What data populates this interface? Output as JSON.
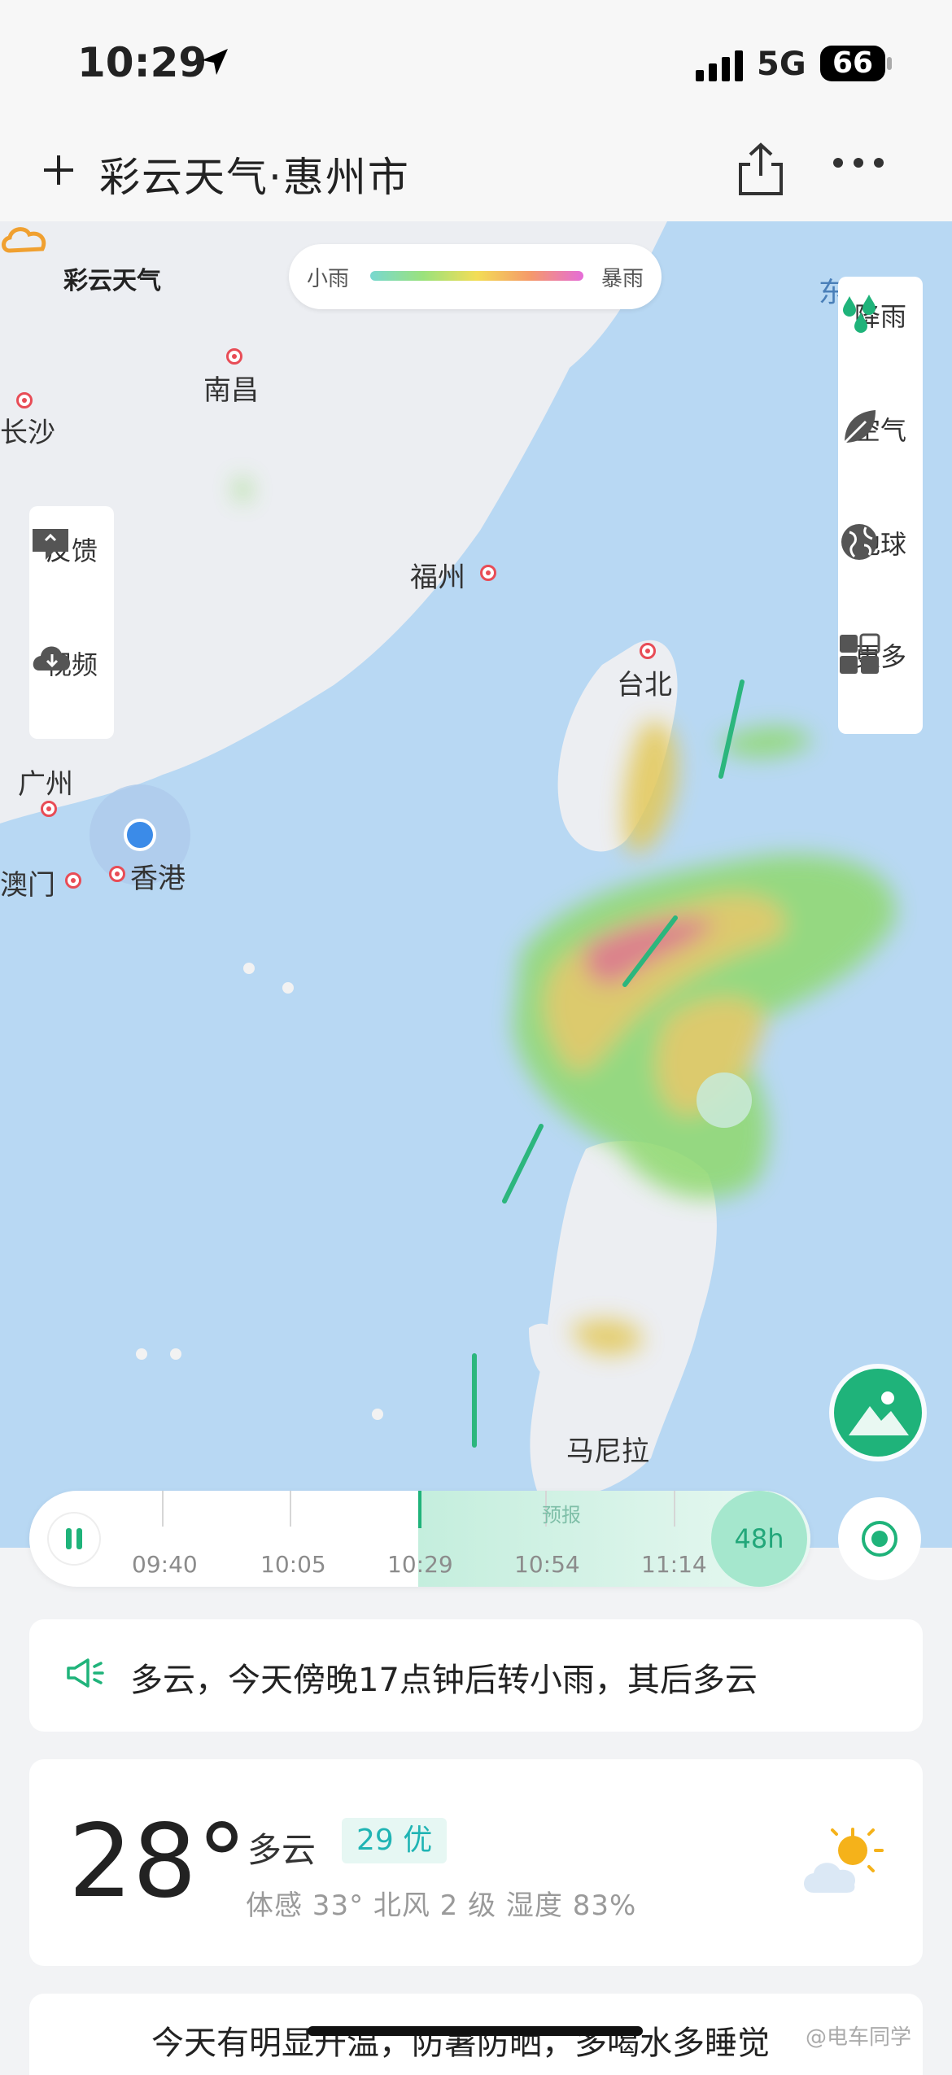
{
  "status_bar": {
    "time": "10:29",
    "network": "5G",
    "battery": "66"
  },
  "header": {
    "title": "彩云天气·惠州市"
  },
  "map": {
    "brand": "彩云天气",
    "legend": {
      "min_label": "小雨",
      "max_label": "暴雨"
    },
    "cities": [
      "南昌",
      "长沙",
      "福州",
      "台北",
      "广州",
      "香港",
      "澳门",
      "马尼拉",
      "东"
    ],
    "left_buttons": [
      "反馈",
      "视频"
    ],
    "right_buttons": [
      "降雨",
      "空气",
      "地球",
      "更多"
    ]
  },
  "timeline": {
    "times": [
      "09:40",
      "10:05",
      "10:29",
      "10:54",
      "11:14"
    ],
    "forecast_label": "预报",
    "range_label": "48h"
  },
  "notice": {
    "text": "多云，今天傍晚17点钟后转小雨，其后多云"
  },
  "current": {
    "temp": "28°",
    "condition": "多云",
    "aqi": "29 优",
    "details": "体感 33°  北风 2 级  湿度 83%"
  },
  "summary": "今天有明显升温，防暑防晒，多喝水多睡觉",
  "watermark": "@电车同学",
  "colors": {
    "accent": "#1fb37a",
    "aqi_text": "#20b4b4"
  }
}
